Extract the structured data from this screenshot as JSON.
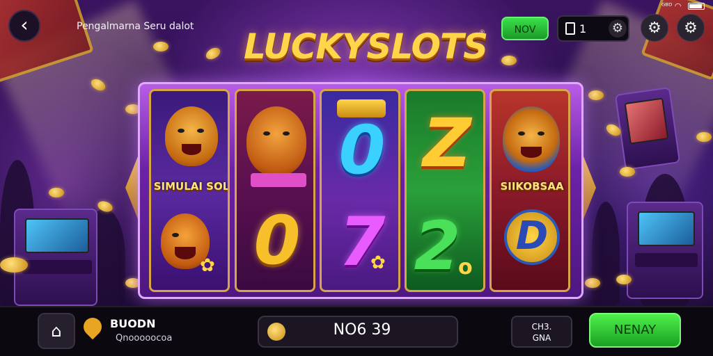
{
  "header": {
    "back_icon": "chevron-left-icon",
    "subtitle": "Pengalmarna Seru dalot",
    "logo": "LUCKYSLOTS",
    "logo_mark": "®",
    "now_label": "NOV",
    "counter_icon": "phone-icon",
    "counter_value": "1",
    "status_icons": [
      "signal-icon",
      "wifi-icon",
      "battery-icon"
    ],
    "status_text": "ᴳᴮᴰ"
  },
  "reels": [
    {
      "top_label": "SIMULAI SOL",
      "top_symbol": "lion",
      "bottom_symbol": "fox-clover"
    },
    {
      "top_symbol": "fox-bowtie",
      "bottom_digit": "0"
    },
    {
      "top_digit": "0",
      "bottom_digit": "7"
    },
    {
      "top_digit": "Z",
      "bottom_digit": "2",
      "bottom_suffix": "o"
    },
    {
      "top_label": "SIIKOBSAA",
      "top_symbol": "lion-blue",
      "bottom_digit": "D"
    }
  ],
  "footer": {
    "home_icon": "home-icon",
    "brand_name": "BUODN",
    "brand_sub": "Qnooooocoa",
    "bet_value": "NO6 39",
    "small_box_line1": "CH3.",
    "small_box_line2": "GNA",
    "play_label": "NENAY"
  },
  "colors": {
    "accent_green": "#2ecc40",
    "gold": "#ffd54a",
    "frame_purple": "#7c2bbf"
  }
}
